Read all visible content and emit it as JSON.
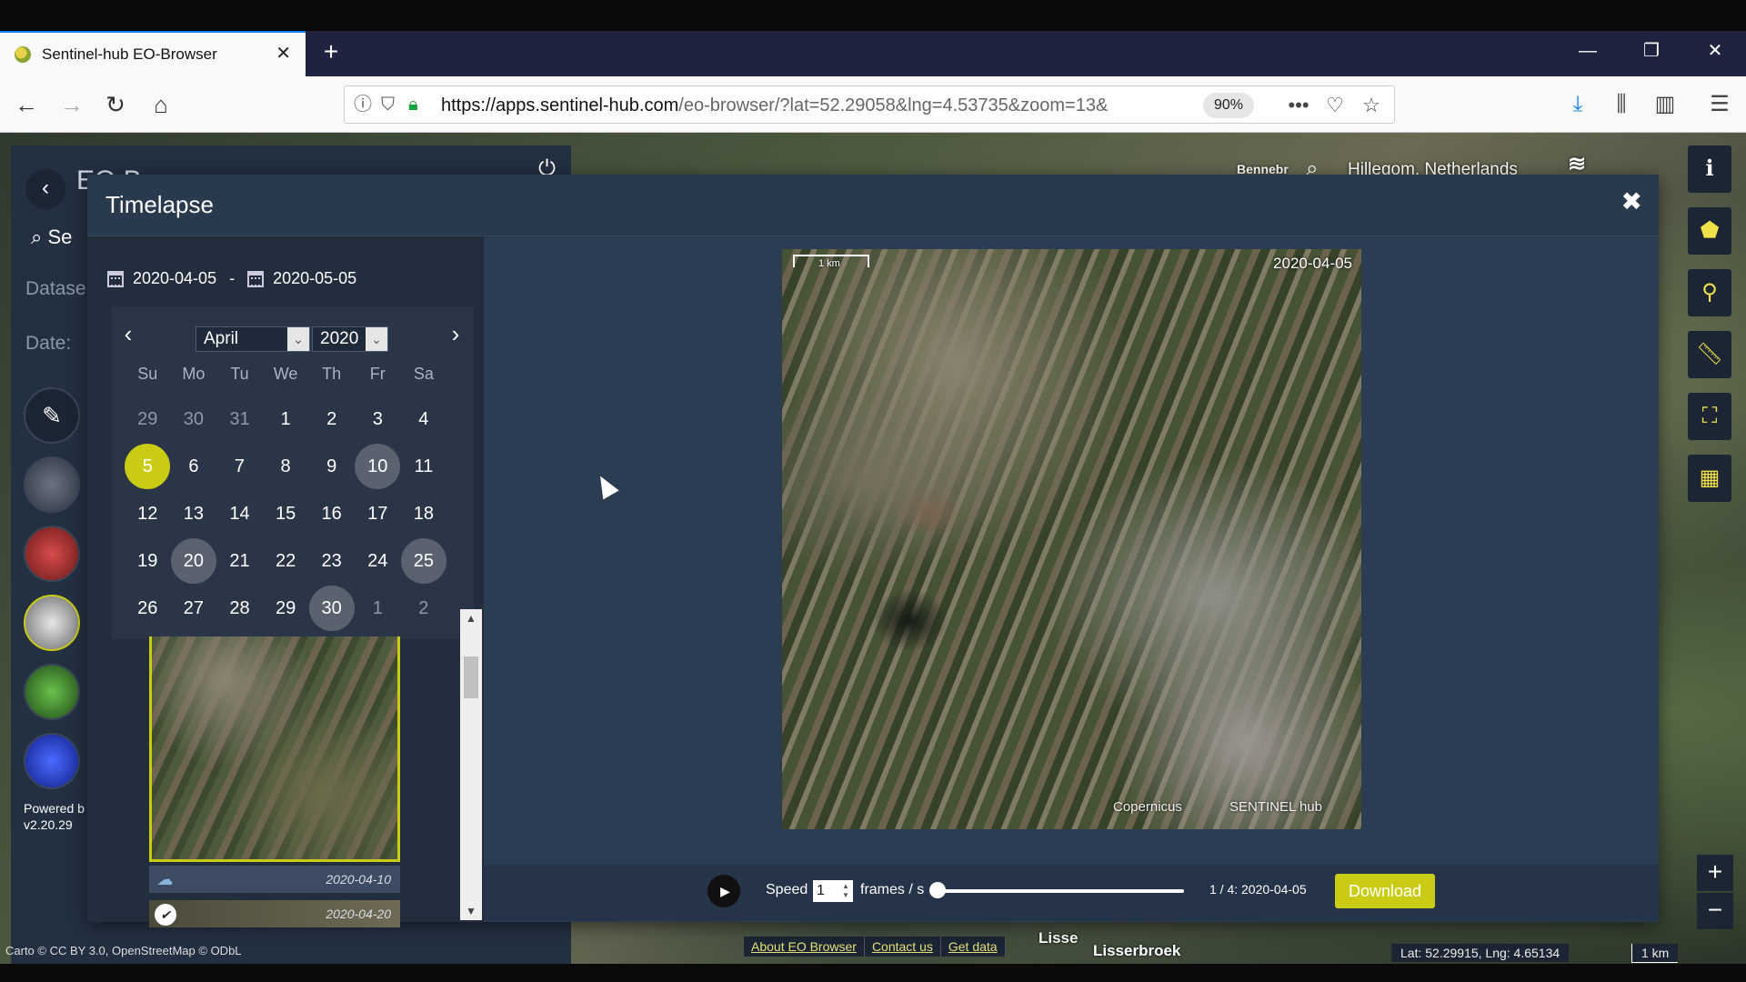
{
  "browser": {
    "tab_title": "Sentinel-hub EO-Browser",
    "tab_close": "✕",
    "new_tab": "+",
    "url_domain": "https://apps.sentinel-hub.com",
    "url_rest": "/eo-browser/?lat=52.29058&lng=4.53735&zoom=13&",
    "zoom": "90%",
    "more": "•••",
    "win_min": "—",
    "win_max": "❐",
    "win_close": "✕"
  },
  "eo": {
    "logo": "EO B",
    "search": "Se",
    "dataset_label": "Datase",
    "date_label": "Date:",
    "powered": "Powered b",
    "version": "v2.20.29"
  },
  "map": {
    "place_top": "Hillegom, Netherlands",
    "place_partial": "Bennebr",
    "place_lisse": "Lisse",
    "place_lisserbroek": "Lisserbroek",
    "attribution": "Carto © CC BY 3.0, OpenStreetMap © ODbL",
    "links": [
      "About EO Browser",
      "Contact us",
      "Get data"
    ],
    "coords": "Lat: 52.29915, Lng: 4.65134",
    "scale": "1 km",
    "zoom_in": "+",
    "zoom_out": "−"
  },
  "timelapse": {
    "title": "Timelapse",
    "close": "✖",
    "date_from": "2020-04-05",
    "date_sep": "-",
    "date_to": "2020-05-05",
    "calendar": {
      "month": "April",
      "year": "2020",
      "weekdays": [
        "Su",
        "Mo",
        "Tu",
        "We",
        "Th",
        "Fr",
        "Sa"
      ],
      "days": [
        {
          "d": "29",
          "state": "muted"
        },
        {
          "d": "30",
          "state": "muted"
        },
        {
          "d": "31",
          "state": "muted"
        },
        {
          "d": "1",
          "state": ""
        },
        {
          "d": "2",
          "state": ""
        },
        {
          "d": "3",
          "state": ""
        },
        {
          "d": "4",
          "state": ""
        },
        {
          "d": "5",
          "state": "selected"
        },
        {
          "d": "6",
          "state": ""
        },
        {
          "d": "7",
          "state": ""
        },
        {
          "d": "8",
          "state": ""
        },
        {
          "d": "9",
          "state": ""
        },
        {
          "d": "10",
          "state": "avail"
        },
        {
          "d": "11",
          "state": ""
        },
        {
          "d": "12",
          "state": ""
        },
        {
          "d": "13",
          "state": ""
        },
        {
          "d": "14",
          "state": ""
        },
        {
          "d": "15",
          "state": ""
        },
        {
          "d": "16",
          "state": ""
        },
        {
          "d": "17",
          "state": ""
        },
        {
          "d": "18",
          "state": ""
        },
        {
          "d": "19",
          "state": ""
        },
        {
          "d": "20",
          "state": "avail"
        },
        {
          "d": "21",
          "state": ""
        },
        {
          "d": "22",
          "state": ""
        },
        {
          "d": "23",
          "state": ""
        },
        {
          "d": "24",
          "state": ""
        },
        {
          "d": "25",
          "state": "avail"
        },
        {
          "d": "26",
          "state": ""
        },
        {
          "d": "27",
          "state": ""
        },
        {
          "d": "28",
          "state": ""
        },
        {
          "d": "29",
          "state": ""
        },
        {
          "d": "30",
          "state": "avail"
        },
        {
          "d": "1",
          "state": "muted"
        },
        {
          "d": "2",
          "state": "muted"
        }
      ]
    },
    "thumbs": [
      {
        "date": "2020-04-10"
      },
      {
        "date": "2020-04-20"
      }
    ],
    "preview": {
      "date": "2020-04-05",
      "scale": "1 km",
      "copernicus": "Copernicus",
      "sentinel": "SENTINEL hub"
    },
    "controls": {
      "speed_label": "Speed",
      "speed_value": "1",
      "fps_label": "frames / s",
      "frame_info": "1 / 4: 2020-04-05",
      "download": "Download"
    }
  },
  "colors": {
    "accent": "#c9cc13",
    "panel": "#2c3c52"
  }
}
